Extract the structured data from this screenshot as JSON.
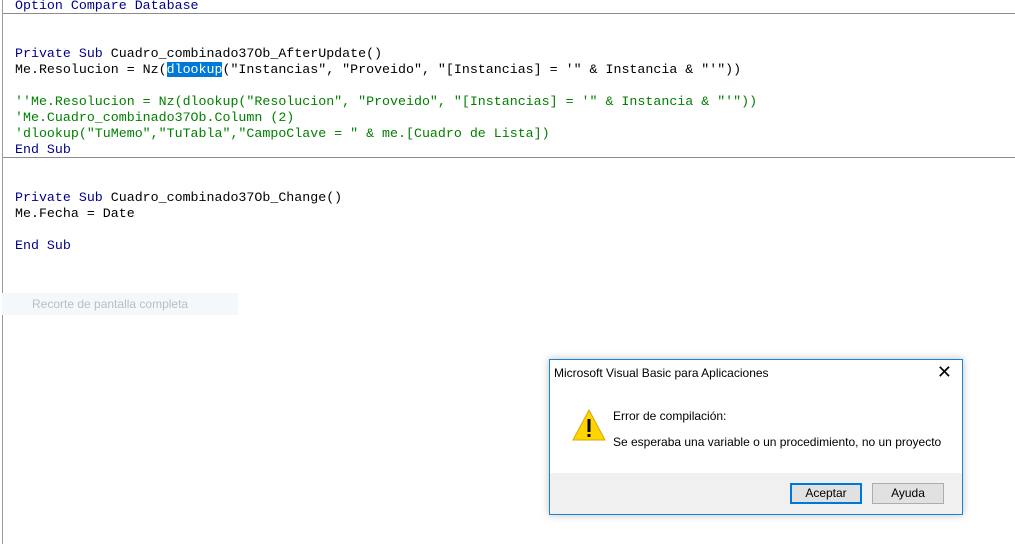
{
  "code": {
    "header": "Option Compare Database",
    "sub1": {
      "decl_kw": "Private Sub",
      "decl_name": " Cuadro_combinado37Ob_AfterUpdate()",
      "line1_pre": "Me.Resolucion = Nz(",
      "line1_sel": "dlookup",
      "line1_post": "(\"Instancias\", \"Proveido\", \"[Instancias] = '\" & Instancia & \"'\"))",
      "comment1": "''Me.Resolucion = Nz(dlookup(\"Resolucion\", \"Proveido\", \"[Instancias] = '\" & Instancia & \"'\"))",
      "comment2": "'Me.Cuadro_combinado37Ob.Column (2)",
      "comment3": "'dlookup(\"TuMemo\",\"TuTabla\",\"CampoClave = \" & me.[Cuadro de Lista])",
      "end": "End Sub"
    },
    "sub2": {
      "decl_kw": "Private Sub",
      "decl_name": " Cuadro_combinado37Ob_Change()",
      "line1": "Me.Fecha = Date",
      "end": "End Sub"
    }
  },
  "snip_hint": "Recorte de pantalla completa",
  "dialog": {
    "title": "Microsoft Visual Basic para Aplicaciones",
    "icon": "warning-icon",
    "heading": "Error de compilación:",
    "message": "Se esperaba una variable o un procedimiento, no un proyecto",
    "ok_label": "Aceptar",
    "help_label": "Ayuda",
    "close_glyph": "✕"
  },
  "colors": {
    "keyword": "#00008b",
    "comment": "#008000",
    "selection": "#0078d7",
    "warning": "#ffd400"
  }
}
